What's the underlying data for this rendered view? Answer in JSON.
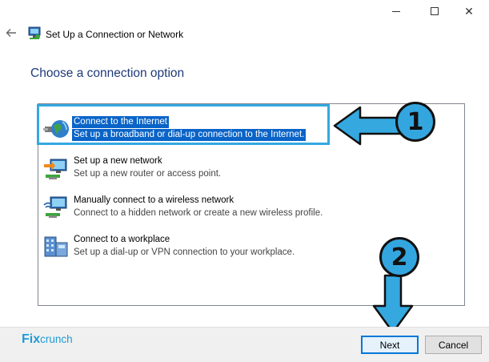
{
  "window": {
    "title": "Set Up a Connection or Network",
    "minimize_glyph": "",
    "close_glyph": "✕"
  },
  "heading": "Choose a connection option",
  "options": [
    {
      "title": "Connect to the Internet",
      "description": "Set up a broadband or dial-up connection to the Internet.",
      "icon": "globe-network-icon",
      "selected": true
    },
    {
      "title": "Set up a new network",
      "description": "Set up a new router or access point.",
      "icon": "new-network-icon",
      "selected": false
    },
    {
      "title": "Manually connect to a wireless network",
      "description": "Connect to a hidden network or create a new wireless profile.",
      "icon": "wireless-network-icon",
      "selected": false
    },
    {
      "title": "Connect to a workplace",
      "description": "Set up a dial-up or VPN connection to your workplace.",
      "icon": "workplace-icon",
      "selected": false
    }
  ],
  "buttons": {
    "next": "Next",
    "cancel": "Cancel"
  },
  "watermark": {
    "part1": "Fix",
    "part2": "crunch"
  },
  "annotations": {
    "step1": "1",
    "step2": "2",
    "accent_color": "#35a8e0"
  },
  "colors": {
    "selection": "#0a64c8",
    "heading": "#1f3a78"
  }
}
